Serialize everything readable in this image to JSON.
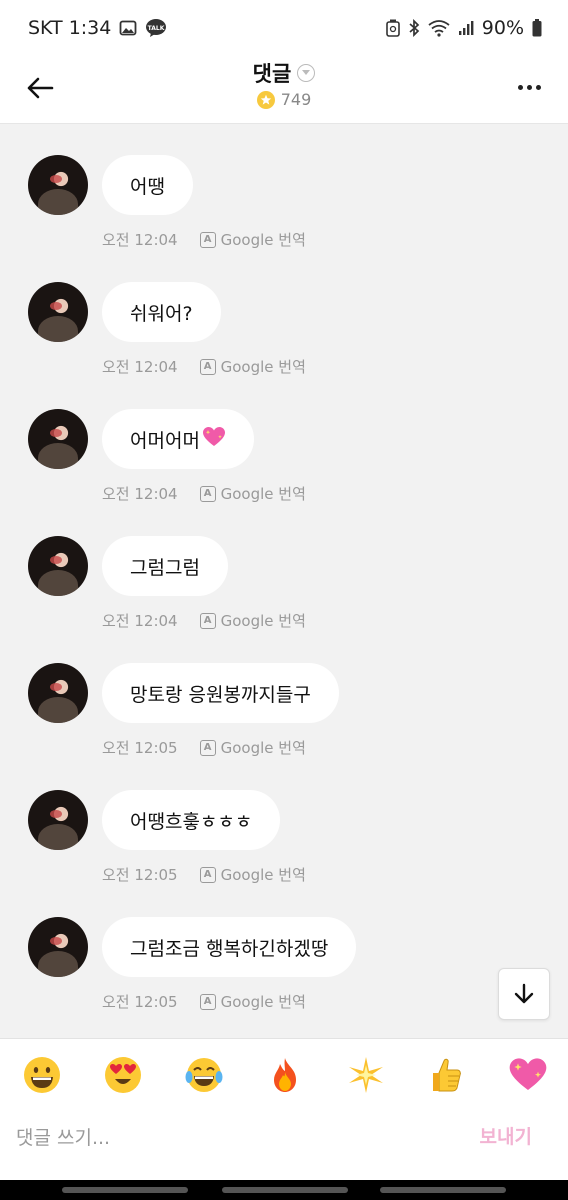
{
  "status_bar": {
    "carrier_time": "SKT 1:34",
    "battery": "90%"
  },
  "header": {
    "title": "댓글",
    "count": "749"
  },
  "comments": [
    {
      "text": "어땡",
      "time": "오전 12:04",
      "translate": "Google 번역"
    },
    {
      "text": "쉬워어?",
      "time": "오전 12:04",
      "translate": "Google 번역"
    },
    {
      "text": "어머어머",
      "emoji": "sparkling-heart-icon",
      "time": "오전 12:04",
      "translate": "Google 번역"
    },
    {
      "text": "그럼그럼",
      "time": "오전 12:04",
      "translate": "Google 번역"
    },
    {
      "text": "망토랑 응원봉까지들구",
      "time": "오전 12:05",
      "translate": "Google 번역"
    },
    {
      "text": "어땡흐흫ㅎㅎㅎ",
      "time": "오전 12:05",
      "translate": "Google 번역"
    },
    {
      "text": "그럼조금 행복하긴하겠땅",
      "time": "오전 12:05",
      "translate": "Google 번역"
    }
  ],
  "emoji_bar": [
    "grinning-face-icon",
    "heart-eyes-icon",
    "tears-of-joy-icon",
    "fire-icon",
    "sparkle-star-icon",
    "thumbs-up-icon",
    "sparkling-heart-icon"
  ],
  "input": {
    "placeholder": "댓글 쓰기...",
    "send_label": "보내기"
  },
  "colors": {
    "background": "#f2f2f2",
    "bubble": "#ffffff",
    "send_disabled": "#f2b3d2",
    "star": "#f7c93e"
  }
}
